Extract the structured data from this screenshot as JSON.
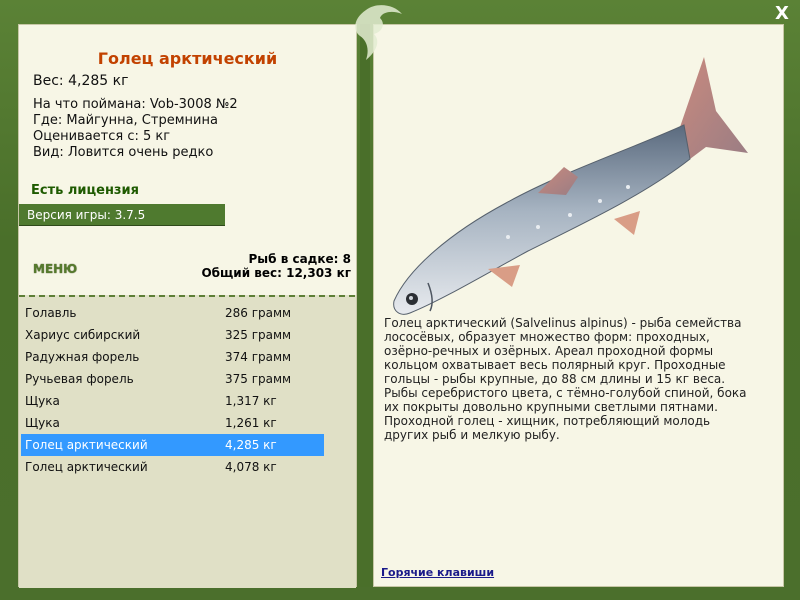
{
  "header": {
    "close_label": "X"
  },
  "fish": {
    "title": "Голец арктический",
    "weight_line": "Вес: 4,285 кг",
    "caught_on": "На что поймана: Vob-3008 №2",
    "location": "Где: Майгунна, Стремнина",
    "valued_from": "Оценивается с: 5 кг",
    "rarity": "Вид: Ловится очень редко",
    "license": "Есть лицензия",
    "version": "Версия игры: 3.7.5",
    "description": "Голец арктический (Salvelinus alpinus) - рыба семейства лососёвых, образует множество форм: проходных, озёрно-речных и озёрных. Ареал проходной формы кольцом охватывает весь полярный круг. Проходные гольцы - рыбы крупные, до 88 см длины и 15 кг веса. Рыбы серебристого цвета, с тёмно-голубой спиной, бока их покрыты довольно крупными светлыми пятнами. Проходной голец - хищник, потребляющий молодь других рыб и мелкую рыбу."
  },
  "menu": {
    "label": "МЕНЮ"
  },
  "keepnet": {
    "count_line": "Рыб в садке: 8",
    "total_line": "Общий вес: 12,303 кг"
  },
  "catch_list": [
    {
      "name": "Голавль",
      "weight": "286 грамм",
      "selected": false
    },
    {
      "name": "Хариус сибирский",
      "weight": "325 грамм",
      "selected": false
    },
    {
      "name": "Радужная форель",
      "weight": "374 грамм",
      "selected": false
    },
    {
      "name": "Ручьевая форель",
      "weight": "375 грамм",
      "selected": false
    },
    {
      "name": "Щука",
      "weight": "1,317 кг",
      "selected": false
    },
    {
      "name": "Щука",
      "weight": "1,261 кг",
      "selected": false
    },
    {
      "name": "Голец арктический",
      "weight": "4,285 кг",
      "selected": true
    },
    {
      "name": "Голец арктический",
      "weight": "4,078 кг",
      "selected": false
    }
  ],
  "links": {
    "hotkeys": "Горячие клавиши"
  },
  "colors": {
    "frame": "#4a6f2a",
    "panel": "#f7f6e6",
    "title": "#c24200",
    "selection": "#3399ff",
    "license": "#1e5a00"
  }
}
